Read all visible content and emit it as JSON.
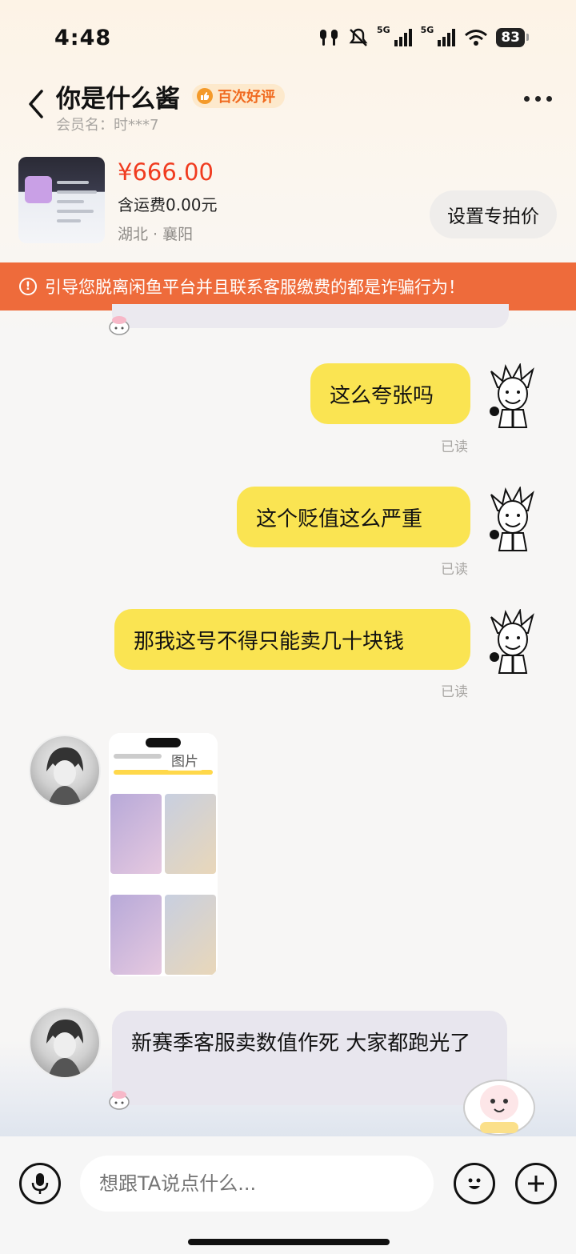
{
  "status": {
    "time": "4:48",
    "signal1": "5G",
    "signal2": "5G",
    "battery": "83"
  },
  "header": {
    "title": "你是什么酱",
    "badge": "百次好评",
    "member": "会员名：时***7"
  },
  "product": {
    "price": "¥666.00",
    "shipping": "含运费0.00元",
    "location": "湖北 · 襄阳",
    "action_button": "设置专拍价"
  },
  "warning": "引导您脱离闲鱼平台并且联系客服缴费的都是诈骗行为！",
  "messages": [
    {
      "text": "这么夸张吗",
      "status": "已读"
    },
    {
      "text": "这个贬值这么严重",
      "status": "已读"
    },
    {
      "text": "那我这号不得只能卖几十块钱",
      "status": "已读"
    },
    {
      "image_label": "图片"
    },
    {
      "text": "新赛季客服卖数值作死 大家都跑光了"
    }
  ],
  "composer": {
    "placeholder": "想跟TA说点什么..."
  },
  "colors": {
    "accent_yellow": "#fae452",
    "warning_orange": "#ee6b3b",
    "price_red": "#f03b1f"
  }
}
